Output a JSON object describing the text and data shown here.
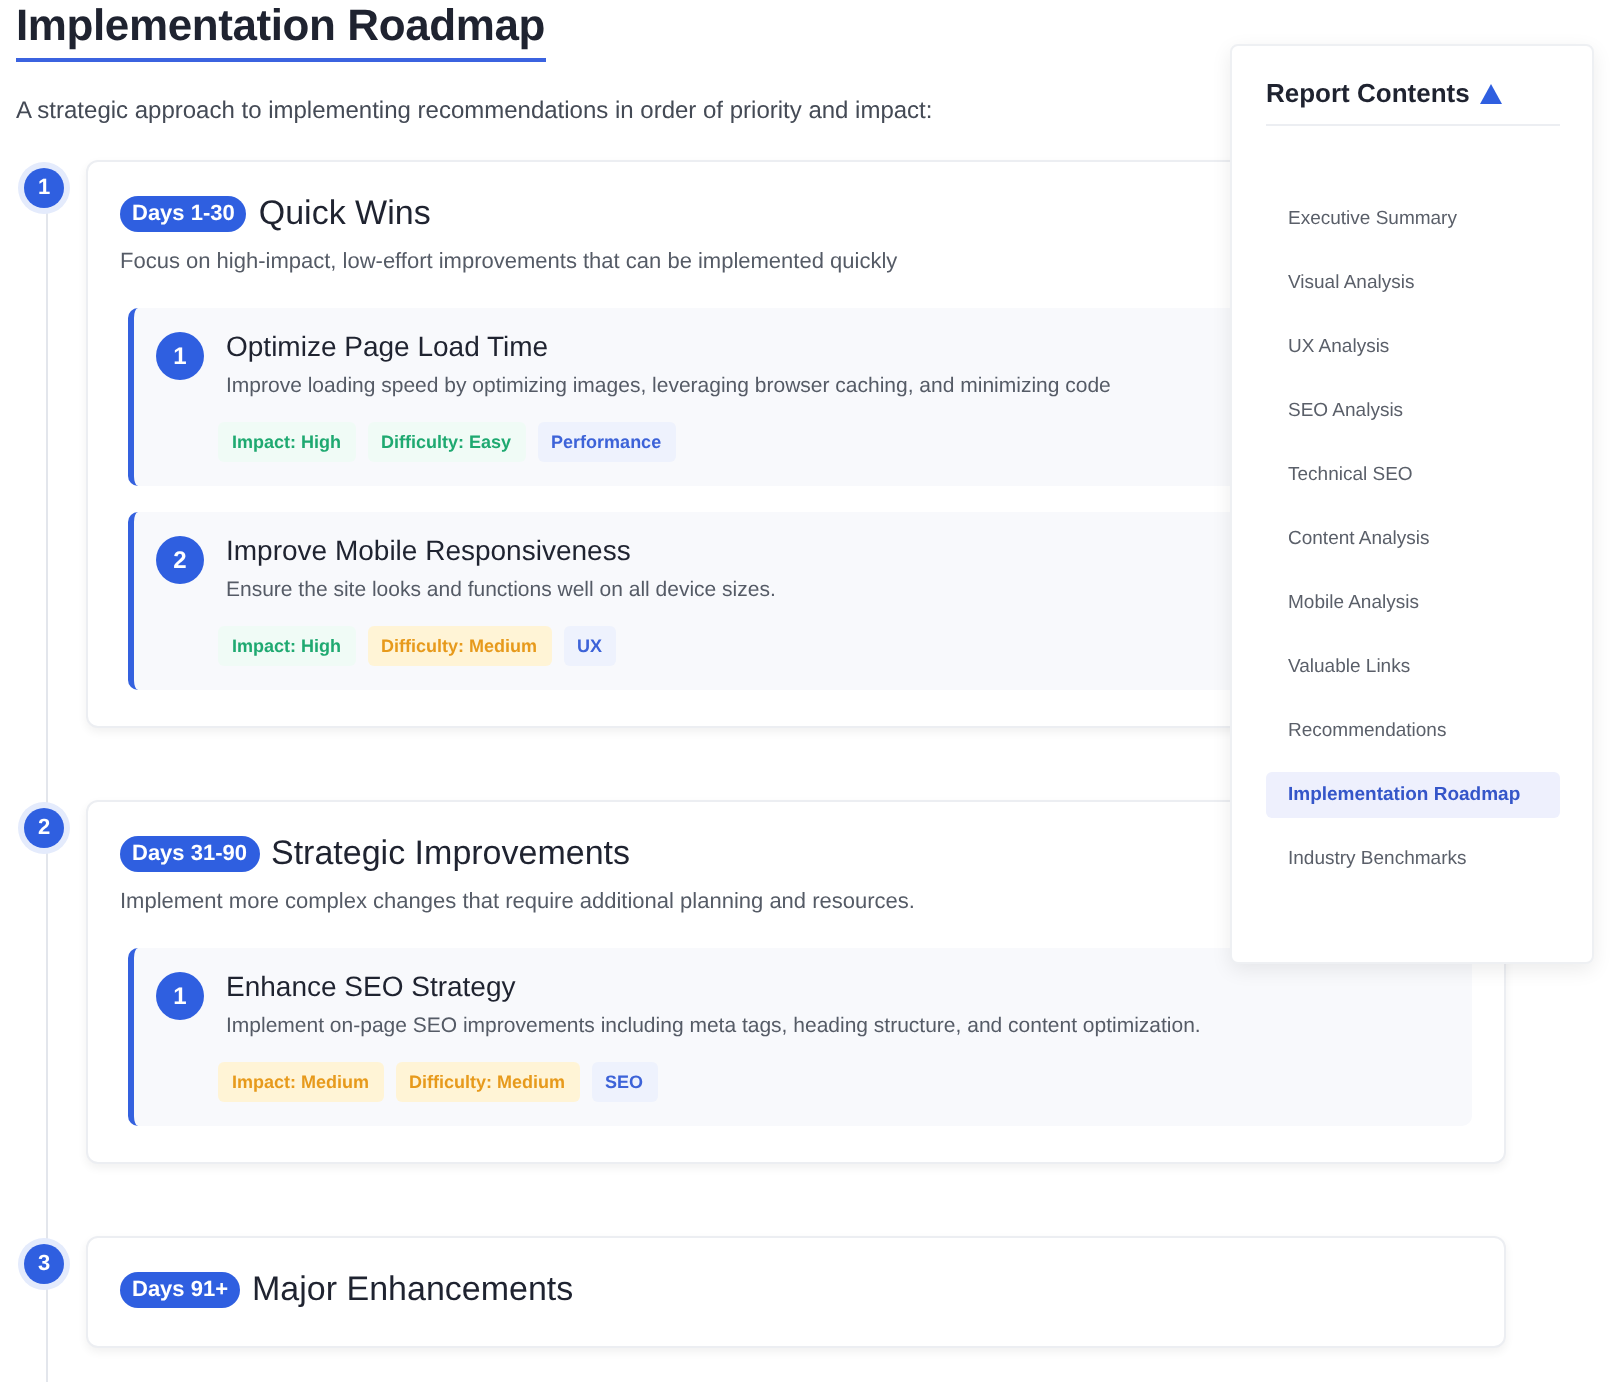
{
  "title": "Implementation Roadmap",
  "intro": "A strategic approach to implementing recommendations in order of priority and impact:",
  "phases": [
    {
      "number": "1",
      "badge": "Days 1-30",
      "title": "Quick Wins",
      "description": "Focus on high-impact, low-effort improvements that can be implemented quickly",
      "tasks": [
        {
          "number": "1",
          "title": "Optimize Page Load Time",
          "description": "Improve loading speed by optimizing images, leveraging browser caching, and minimizing code",
          "tags": [
            {
              "text": "Impact: High",
              "kind": "good"
            },
            {
              "text": "Difficulty: Easy",
              "kind": "good"
            },
            {
              "text": "Performance",
              "kind": "category"
            }
          ]
        },
        {
          "number": "2",
          "title": "Improve Mobile Responsiveness",
          "description": "Ensure the site looks and functions well on all device sizes.",
          "tags": [
            {
              "text": "Impact: High",
              "kind": "good"
            },
            {
              "text": "Difficulty: Medium",
              "kind": "moderate"
            },
            {
              "text": "UX",
              "kind": "category"
            }
          ]
        }
      ]
    },
    {
      "number": "2",
      "badge": "Days 31-90",
      "title": "Strategic Improvements",
      "description": "Implement more complex changes that require additional planning and resources.",
      "tasks": [
        {
          "number": "1",
          "title": "Enhance SEO Strategy",
          "description": "Implement on-page SEO improvements including meta tags, heading structure, and content optimization.",
          "tags": [
            {
              "text": "Impact: Medium",
              "kind": "moderate"
            },
            {
              "text": "Difficulty: Medium",
              "kind": "moderate"
            },
            {
              "text": "SEO",
              "kind": "category"
            }
          ]
        }
      ]
    },
    {
      "number": "3",
      "badge": "Days 91+",
      "title": "Major Enhancements"
    }
  ],
  "contents": {
    "title": "Report Contents",
    "expanded": true,
    "items": [
      {
        "label": "Executive Summary",
        "selected": false
      },
      {
        "label": "Visual Analysis",
        "selected": false
      },
      {
        "label": "UX Analysis",
        "selected": false
      },
      {
        "label": "SEO Analysis",
        "selected": false
      },
      {
        "label": "Technical SEO",
        "selected": false
      },
      {
        "label": "Content Analysis",
        "selected": false
      },
      {
        "label": "Mobile Analysis",
        "selected": false
      },
      {
        "label": "Valuable Links",
        "selected": false
      },
      {
        "label": "Recommendations",
        "selected": false
      },
      {
        "label": "Implementation Roadmap",
        "selected": true
      },
      {
        "label": "Industry Benchmarks",
        "selected": false
      }
    ]
  }
}
